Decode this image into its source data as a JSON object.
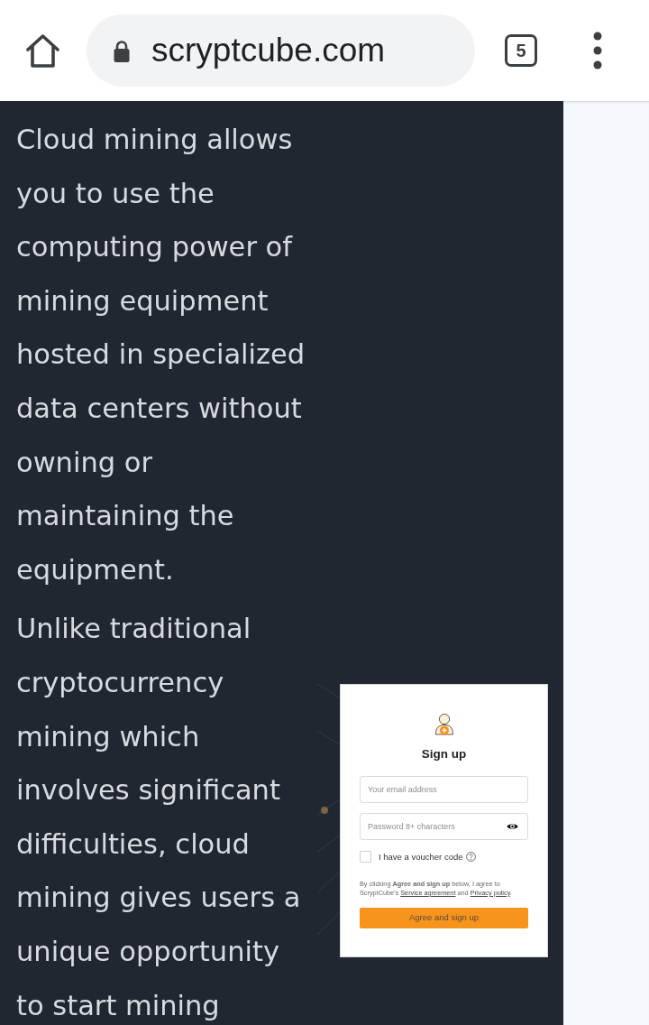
{
  "browser": {
    "url": "scryptcube.com",
    "tab_count": "5"
  },
  "article": {
    "paragraphs": [
      "Cloud mining allows you to use the computing power of mining equipment hosted in specialized data centers without owning or maintaining the equipment.",
      "Unlike traditional cryptocurrency mining which involves significant difficulties, cloud mining gives users a unique opportunity to start mining"
    ]
  },
  "signup": {
    "title": "Sign up",
    "fields": [
      {
        "kind": "email",
        "placeholder": "Your email address"
      },
      {
        "kind": "password",
        "placeholder": "Password 8+ characters"
      }
    ],
    "voucher": {
      "label": "I have a voucher code",
      "checked": false
    },
    "legal": [
      {
        "kind": "text",
        "text": "By clicking **Agree and sign up** below, I agree to ScryptCube's "
      },
      {
        "kind": "link",
        "text": "Service agreement"
      },
      {
        "kind": "text",
        "text": " and "
      },
      {
        "kind": "link",
        "text": "Privacy policy"
      },
      {
        "kind": "text",
        "text": "."
      }
    ],
    "button": "Agree and sign up"
  }
}
